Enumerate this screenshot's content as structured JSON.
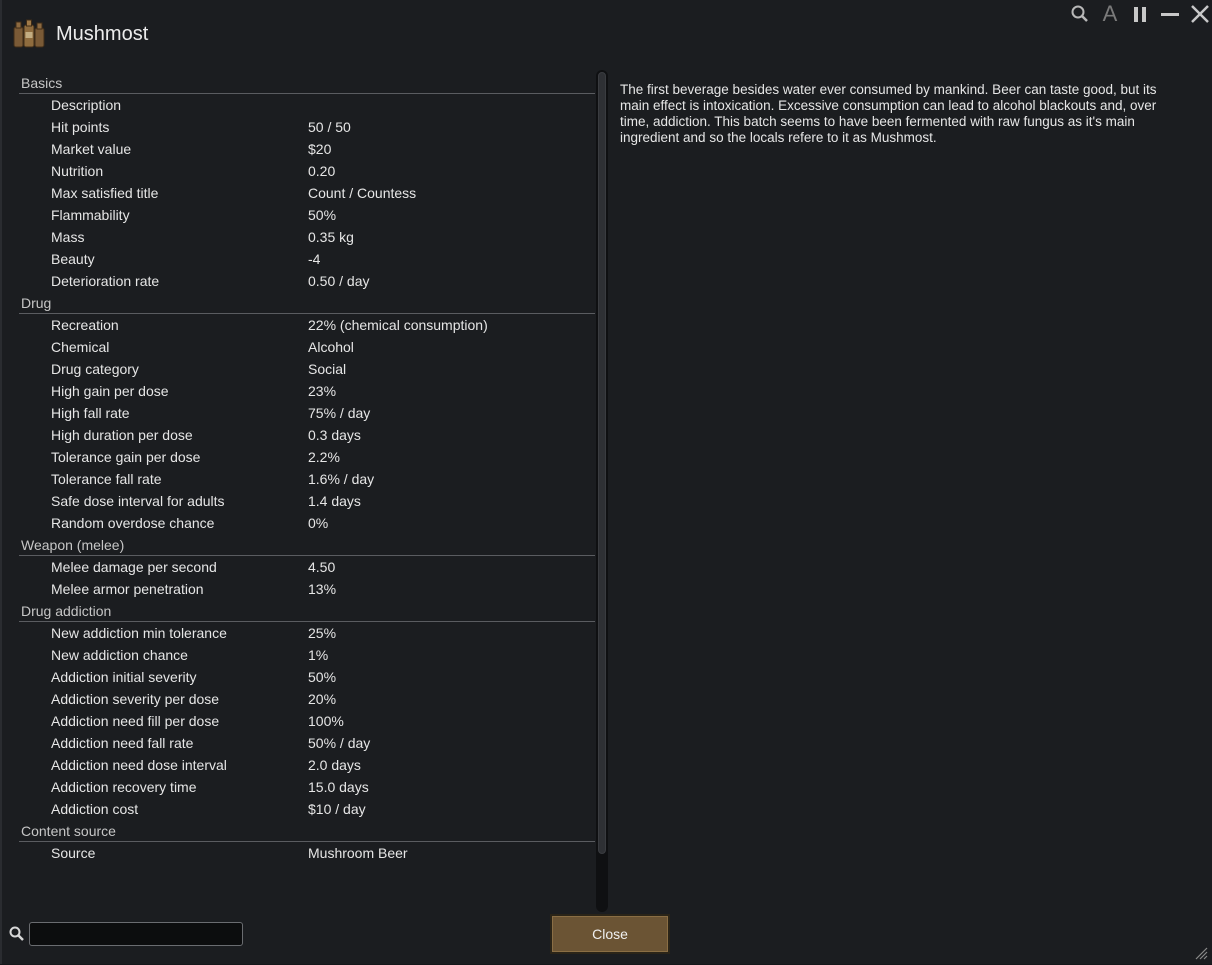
{
  "window": {
    "title": "Mushmost",
    "icon": "beer-bottles-icon",
    "controls": [
      {
        "name": "search-icon"
      },
      {
        "name": "font-icon",
        "glyph": "A"
      },
      {
        "name": "pause-icon"
      },
      {
        "name": "minimize-icon"
      },
      {
        "name": "close-icon"
      }
    ]
  },
  "sections": [
    {
      "title": "Basics",
      "rows": [
        {
          "label": "Description",
          "value": ""
        },
        {
          "label": "Hit points",
          "value": "50 / 50"
        },
        {
          "label": "Market value",
          "value": "$20"
        },
        {
          "label": "Nutrition",
          "value": "0.20"
        },
        {
          "label": "Max satisfied title",
          "value": "Count / Countess"
        },
        {
          "label": "Flammability",
          "value": "50%"
        },
        {
          "label": "Mass",
          "value": "0.35 kg"
        },
        {
          "label": "Beauty",
          "value": "-4"
        },
        {
          "label": "Deterioration rate",
          "value": "0.50 / day"
        }
      ]
    },
    {
      "title": "Drug",
      "rows": [
        {
          "label": "Recreation",
          "value": "22% (chemical consumption)"
        },
        {
          "label": "Chemical",
          "value": "Alcohol"
        },
        {
          "label": "Drug category",
          "value": "Social"
        },
        {
          "label": "High gain per dose",
          "value": "23%"
        },
        {
          "label": "High fall rate",
          "value": "75% / day"
        },
        {
          "label": "High duration per dose",
          "value": "0.3 days"
        },
        {
          "label": "Tolerance gain per dose",
          "value": "2.2%"
        },
        {
          "label": "Tolerance fall rate",
          "value": "1.6% / day"
        },
        {
          "label": "Safe dose interval for adults",
          "value": "1.4 days"
        },
        {
          "label": "Random overdose chance",
          "value": "0%"
        }
      ]
    },
    {
      "title": "Weapon (melee)",
      "rows": [
        {
          "label": "Melee damage per second",
          "value": "4.50"
        },
        {
          "label": "Melee armor penetration",
          "value": "13%"
        }
      ]
    },
    {
      "title": "Drug addiction",
      "rows": [
        {
          "label": "New addiction min tolerance",
          "value": "25%"
        },
        {
          "label": "New addiction chance",
          "value": "1%"
        },
        {
          "label": "Addiction initial severity",
          "value": "50%"
        },
        {
          "label": "Addiction severity per dose",
          "value": "20%"
        },
        {
          "label": "Addiction need fill per dose",
          "value": "100%"
        },
        {
          "label": "Addiction need fall rate",
          "value": "50% / day"
        },
        {
          "label": "Addiction need dose interval",
          "value": "2.0 days"
        },
        {
          "label": "Addiction recovery time",
          "value": "15.0 days"
        },
        {
          "label": "Addiction cost",
          "value": "$10 / day"
        }
      ]
    },
    {
      "title": "Content source",
      "rows": [
        {
          "label": "Source",
          "value": "Mushroom Beer"
        }
      ]
    }
  ],
  "description": "The first beverage besides water ever consumed by mankind. Beer can taste good, but its main effect is intoxication. Excessive consumption can lead to alcohol blackouts and, over time, addiction. This batch seems to have been fermented with raw fungus as it's main ingredient and so the locals refere to it as Mushmost.",
  "search": {
    "value": "",
    "placeholder": ""
  },
  "buttons": {
    "close_label": "Close"
  },
  "colors": {
    "button_bg": "#6b5434",
    "background": "#1b1d20",
    "accent_line": "#5a5c60"
  }
}
